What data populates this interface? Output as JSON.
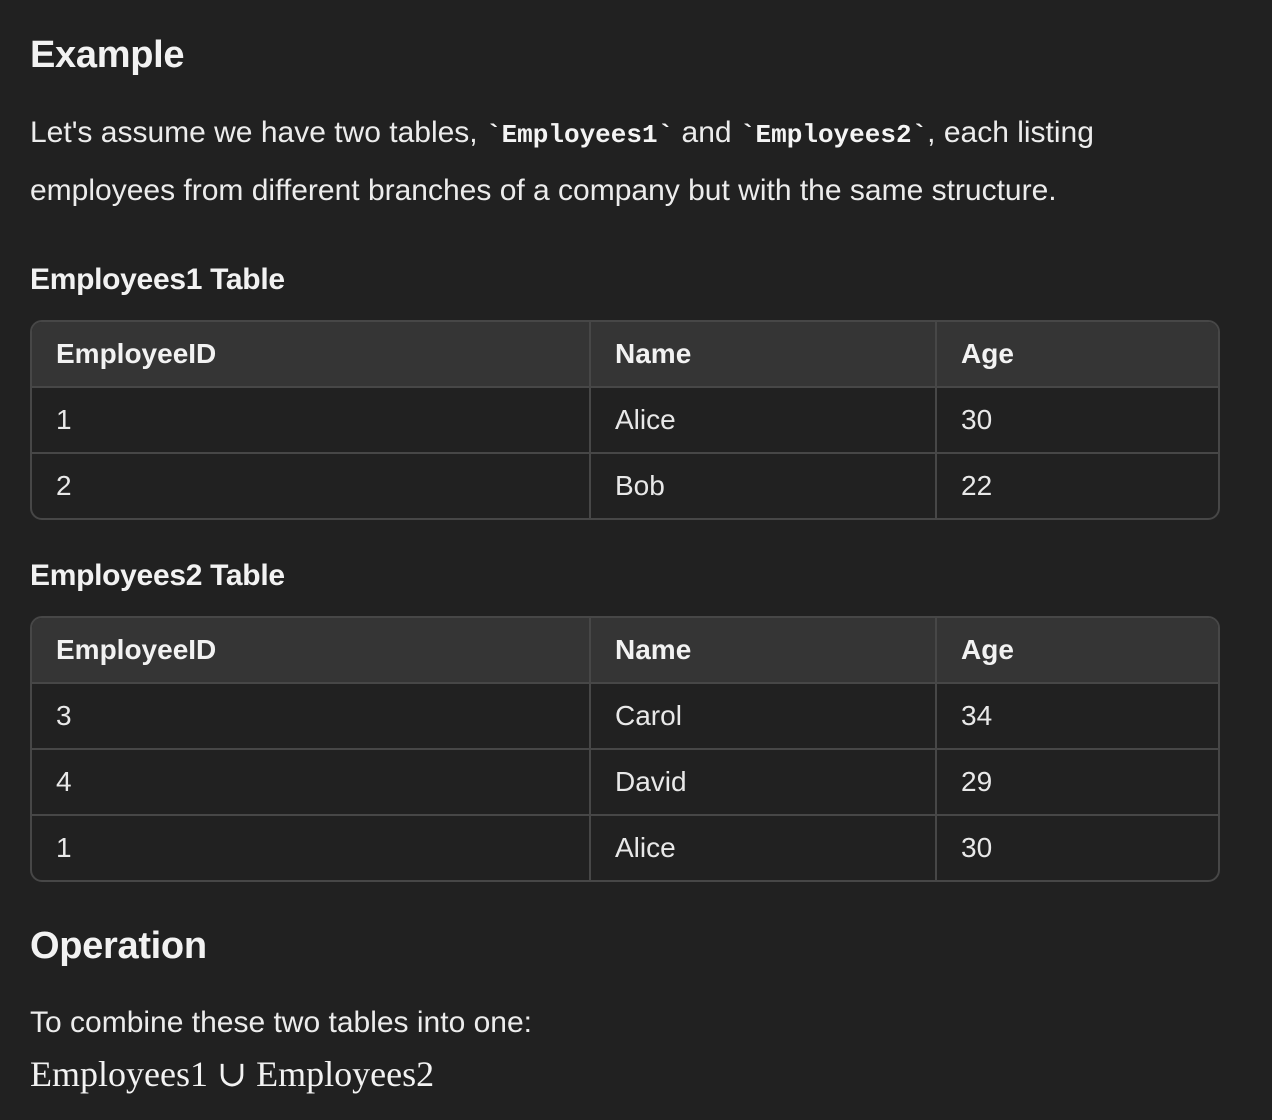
{
  "example": {
    "heading": "Example",
    "intro": {
      "part1": "Let's assume we have two tables, ",
      "code1": "`Employees1`",
      "part2": " and ",
      "code2": "`Employees2`",
      "part3": ", each listing employees from different branches of a company but with the same structure."
    }
  },
  "table1": {
    "heading": "Employees1 Table",
    "headers": [
      "EmployeeID",
      "Name",
      "Age"
    ],
    "rows": [
      [
        "1",
        "Alice",
        "30"
      ],
      [
        "2",
        "Bob",
        "22"
      ]
    ]
  },
  "table2": {
    "heading": "Employees2 Table",
    "headers": [
      "EmployeeID",
      "Name",
      "Age"
    ],
    "rows": [
      [
        "3",
        "Carol",
        "34"
      ],
      [
        "4",
        "David",
        "29"
      ],
      [
        "1",
        "Alice",
        "30"
      ]
    ]
  },
  "operation": {
    "heading": "Operation",
    "text": "To combine these two tables into one:",
    "formula": "Employees1 ∪ Employees2"
  }
}
